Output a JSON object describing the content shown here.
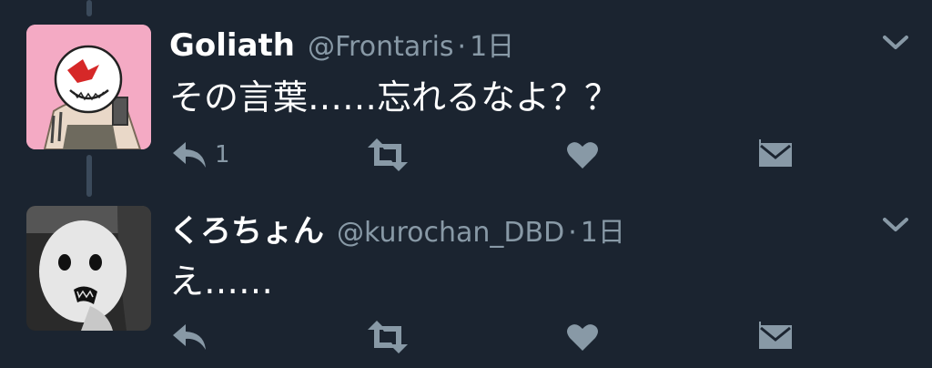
{
  "tweets": [
    {
      "name": "Goliath",
      "handle": "@Frontaris",
      "separator": "·",
      "time": "1日",
      "text": "その言葉……忘れるなよ？？",
      "reply_count": "1"
    },
    {
      "name": "くろちょん",
      "handle": "@kurochan_DBD",
      "separator": "·",
      "time": "1日",
      "text": "え……"
    }
  ],
  "icons": [
    "reply-icon",
    "retweet-icon",
    "like-icon",
    "dm-icon",
    "chevron-down-icon"
  ],
  "colors": {
    "background": "#1b2430",
    "name": "#ffffff",
    "secondary": "#8899a6",
    "icon": "#8899a6",
    "thread_line": "#3b4a5b",
    "avatar1_bg": "#f4aac4"
  }
}
